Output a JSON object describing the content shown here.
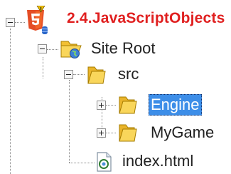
{
  "tree": {
    "project": {
      "label": "2.4.JavaScriptObjects",
      "icon": "html5-project-icon",
      "badge": "warning-badge-icon"
    },
    "site_root": {
      "label": "Site Root",
      "icon": "site-root-folder-icon"
    },
    "src": {
      "label": "src",
      "icon": "folder-icon"
    },
    "engine": {
      "label": "Engine",
      "icon": "folder-icon",
      "selected": true
    },
    "mygame": {
      "label": "MyGame",
      "icon": "folder-icon"
    },
    "index_html": {
      "label": "index.html",
      "icon": "html-file-icon"
    }
  },
  "colors": {
    "project_text": "#e02020",
    "selection": "#3d8ee8",
    "folder": "#f2c033",
    "html5": "#e44d26"
  }
}
